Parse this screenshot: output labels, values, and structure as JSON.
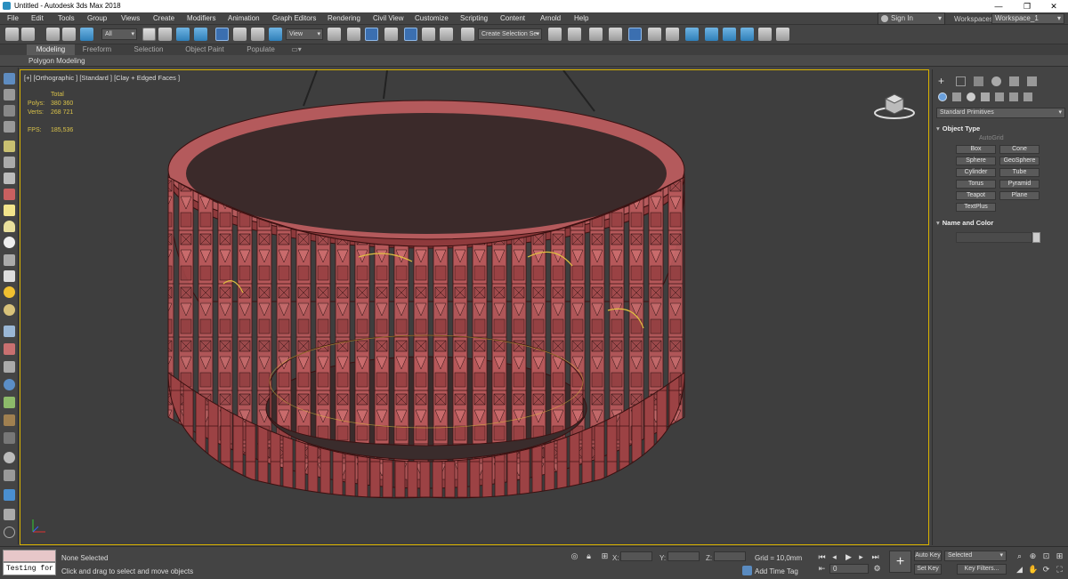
{
  "window": {
    "title": "Untitled - Autodesk 3ds Max 2018",
    "min": "—",
    "max": "❐",
    "close": "✕"
  },
  "menu": [
    "File",
    "Edit",
    "Tools",
    "Group",
    "Views",
    "Create",
    "Modifiers",
    "Animation",
    "Graph Editors",
    "Rendering",
    "Civil View",
    "Customize",
    "Scripting",
    "Content",
    "Arnold",
    "Help"
  ],
  "account": {
    "sign_in": "Sign In",
    "workspaces_label": "Workspaces:",
    "workspace": "Workspace_1"
  },
  "toolbar": {
    "selection_filter": "All",
    "ref_coord": "View",
    "named_selection": "Create Selection Se"
  },
  "ribbon": {
    "tabs": [
      "Modeling",
      "Freeform",
      "Selection",
      "Object Paint",
      "Populate"
    ],
    "active_tab": "Modeling",
    "subpanel": "Polygon Modeling"
  },
  "viewport": {
    "label": "[+] [Orthographic ] [Standard ] [Clay + Edged Faces ]",
    "stats": {
      "header": "Total",
      "polys_label": "Polys:",
      "polys": "380 360",
      "verts_label": "Verts:",
      "verts": "268 721",
      "fps_label": "FPS:",
      "fps": "185,536"
    }
  },
  "command_panel": {
    "category": "Standard Primitives",
    "object_type": {
      "title": "Object Type",
      "autogrid": "AutoGrid",
      "buttons": [
        "Box",
        "Cone",
        "Sphere",
        "GeoSphere",
        "Cylinder",
        "Tube",
        "Torus",
        "Pyramid",
        "Teapot",
        "Plane",
        "TextPlus"
      ]
    },
    "name_and_color": {
      "title": "Name and Color"
    }
  },
  "status": {
    "maxscript_input": "Testing for :",
    "selection": "None Selected",
    "prompt": "Click and drag to select and move objects",
    "x_label": "X:",
    "y_label": "Y:",
    "z_label": "Z:",
    "grid": "Grid = 10,0mm",
    "add_time_tag": "Add Time Tag",
    "frame": "0",
    "auto_key": "Auto Key",
    "set_key": "Set Key",
    "key_selected": "Selected",
    "key_filters": "Key Filters..."
  }
}
